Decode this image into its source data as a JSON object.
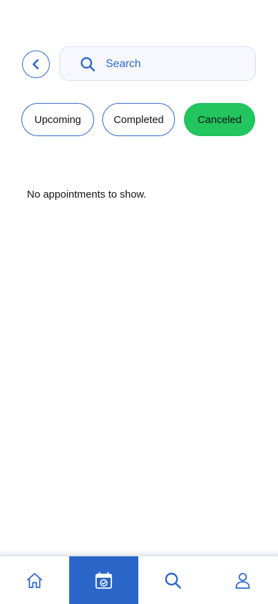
{
  "header": {
    "search_placeholder": "Search"
  },
  "tabs": [
    {
      "label": "Upcoming",
      "active": false
    },
    {
      "label": "Completed",
      "active": false
    },
    {
      "label": "Canceled",
      "active": true
    }
  ],
  "main": {
    "empty_message": "No appointments to show."
  },
  "bottom_nav": [
    {
      "icon": "home-icon",
      "active": false
    },
    {
      "icon": "calendar-check-icon",
      "active": true
    },
    {
      "icon": "search-icon",
      "active": false
    },
    {
      "icon": "profile-icon",
      "active": false
    }
  ],
  "colors": {
    "primary": "#2a66c8",
    "active_tab": "#22c55e",
    "search_bg": "#f6f8fd"
  }
}
